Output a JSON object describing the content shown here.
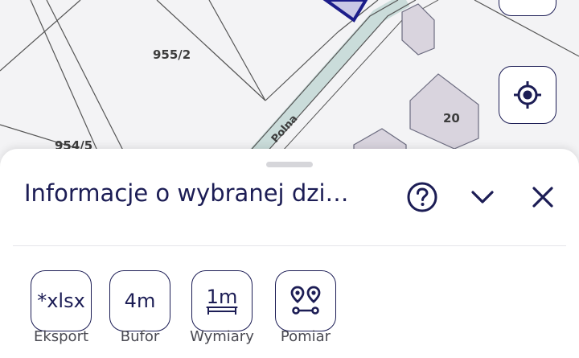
{
  "map": {
    "parcels": [
      {
        "label": "955/2"
      },
      {
        "label": "954/5"
      }
    ],
    "street_label": "Polna",
    "building_number": "20"
  },
  "panel": {
    "title": "Informacje o wybranej dzi…",
    "tools": [
      {
        "icon_text": "*xlsx",
        "caption": "Eksport"
      },
      {
        "icon_text": "4m",
        "caption": "Bufor"
      },
      {
        "icon_text": "1m",
        "caption": "Wymiary"
      },
      {
        "icon": "route-pins-icon",
        "caption": "Pomiar"
      }
    ]
  },
  "icons": {
    "locate": "crosshair-icon",
    "help": "question-circle-icon",
    "collapse": "chevron-down-icon",
    "close": "close-icon"
  },
  "colors": {
    "accent": "#1c1d55",
    "building_fill": "#d9d4de",
    "selected_parcel": "#1c1d8a"
  }
}
